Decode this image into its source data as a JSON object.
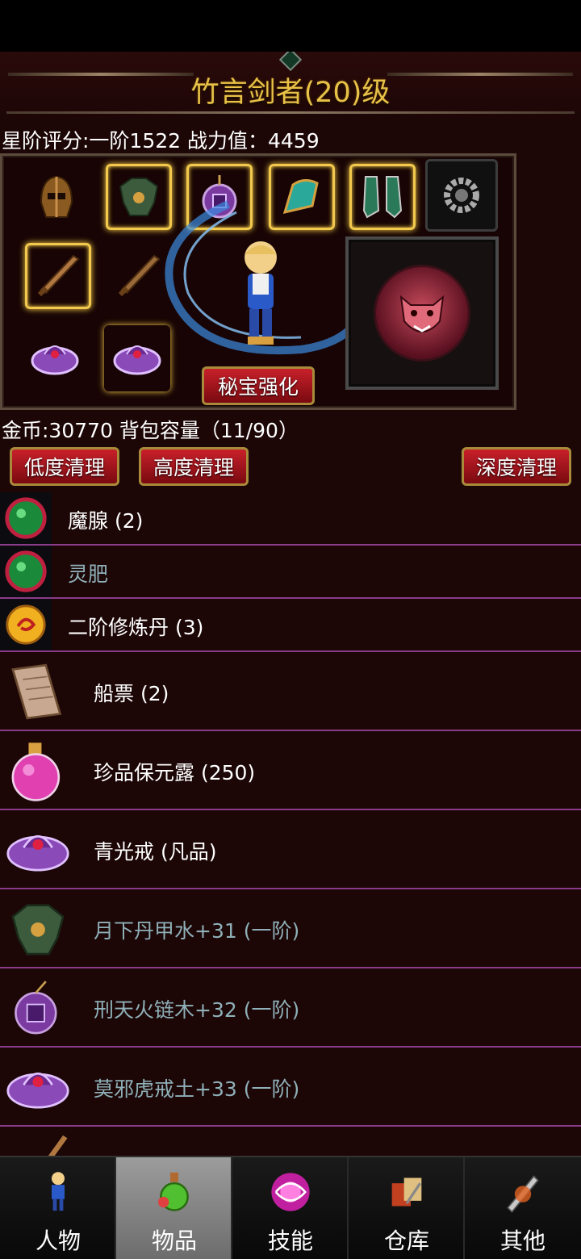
{
  "header": {
    "title": "竹言剑者(20)级"
  },
  "stats": {
    "line": "星阶评分:一阶1522 战力值：4459"
  },
  "equipment": {
    "slots": [
      {
        "icon": "helmet-icon"
      },
      {
        "icon": "armor-icon"
      },
      {
        "icon": "amulet-icon"
      },
      {
        "icon": "bracer-icon"
      },
      {
        "icon": "boots-icon"
      },
      {
        "icon": "bead-bracelet-icon"
      },
      {
        "icon": "sword-icon"
      },
      {
        "icon": "sword-icon"
      },
      {
        "icon": "ring-icon"
      },
      {
        "icon": "ring-icon"
      }
    ],
    "treasure_icon": "tiger-emblem-icon",
    "secret_button": "秘宝强化"
  },
  "inventory": {
    "gold_line": "金币:30770 背包容量（11/90）",
    "btn_low": "低度清理",
    "btn_high": "高度清理",
    "btn_deep": "深度清理",
    "items": [
      {
        "label": "魔腺 (2)",
        "icon": "green-orb-icon",
        "color": "#ffffff"
      },
      {
        "label": "灵肥",
        "icon": "green-orb-icon",
        "color": "#8fb0b8"
      },
      {
        "label": "二阶修炼丹 (3)",
        "icon": "pill-icon",
        "color": "#ffffff"
      },
      {
        "label": "船票 (2)",
        "icon": "scroll-icon",
        "color": "#ffffff"
      },
      {
        "label": "珍品保元露 (250)",
        "icon": "potion-icon",
        "color": "#ffffff"
      },
      {
        "label": "青光戒 (凡品)",
        "icon": "ring-icon",
        "color": "#ffffff"
      },
      {
        "label": "月下丹甲水+31 (一阶)",
        "icon": "armor-icon",
        "color": "#8fb0b8"
      },
      {
        "label": "刑天火链木+32 (一阶)",
        "icon": "amulet-icon",
        "color": "#8fb0b8"
      },
      {
        "label": "莫邪虎戒土+33 (一阶)",
        "icon": "ring-icon",
        "color": "#8fb0b8"
      }
    ]
  },
  "tabs": [
    {
      "label": "人物",
      "icon": "character-icon"
    },
    {
      "label": "物品",
      "icon": "potion-bottle-icon"
    },
    {
      "label": "技能",
      "icon": "skill-orb-icon"
    },
    {
      "label": "仓库",
      "icon": "warehouse-icon"
    },
    {
      "label": "其他",
      "icon": "other-sword-icon"
    }
  ],
  "colors": {
    "title": "#e7c148",
    "item_teal": "#8fb0b8",
    "divider": "#8a3c8a",
    "panel_bg": "#1c0606"
  }
}
